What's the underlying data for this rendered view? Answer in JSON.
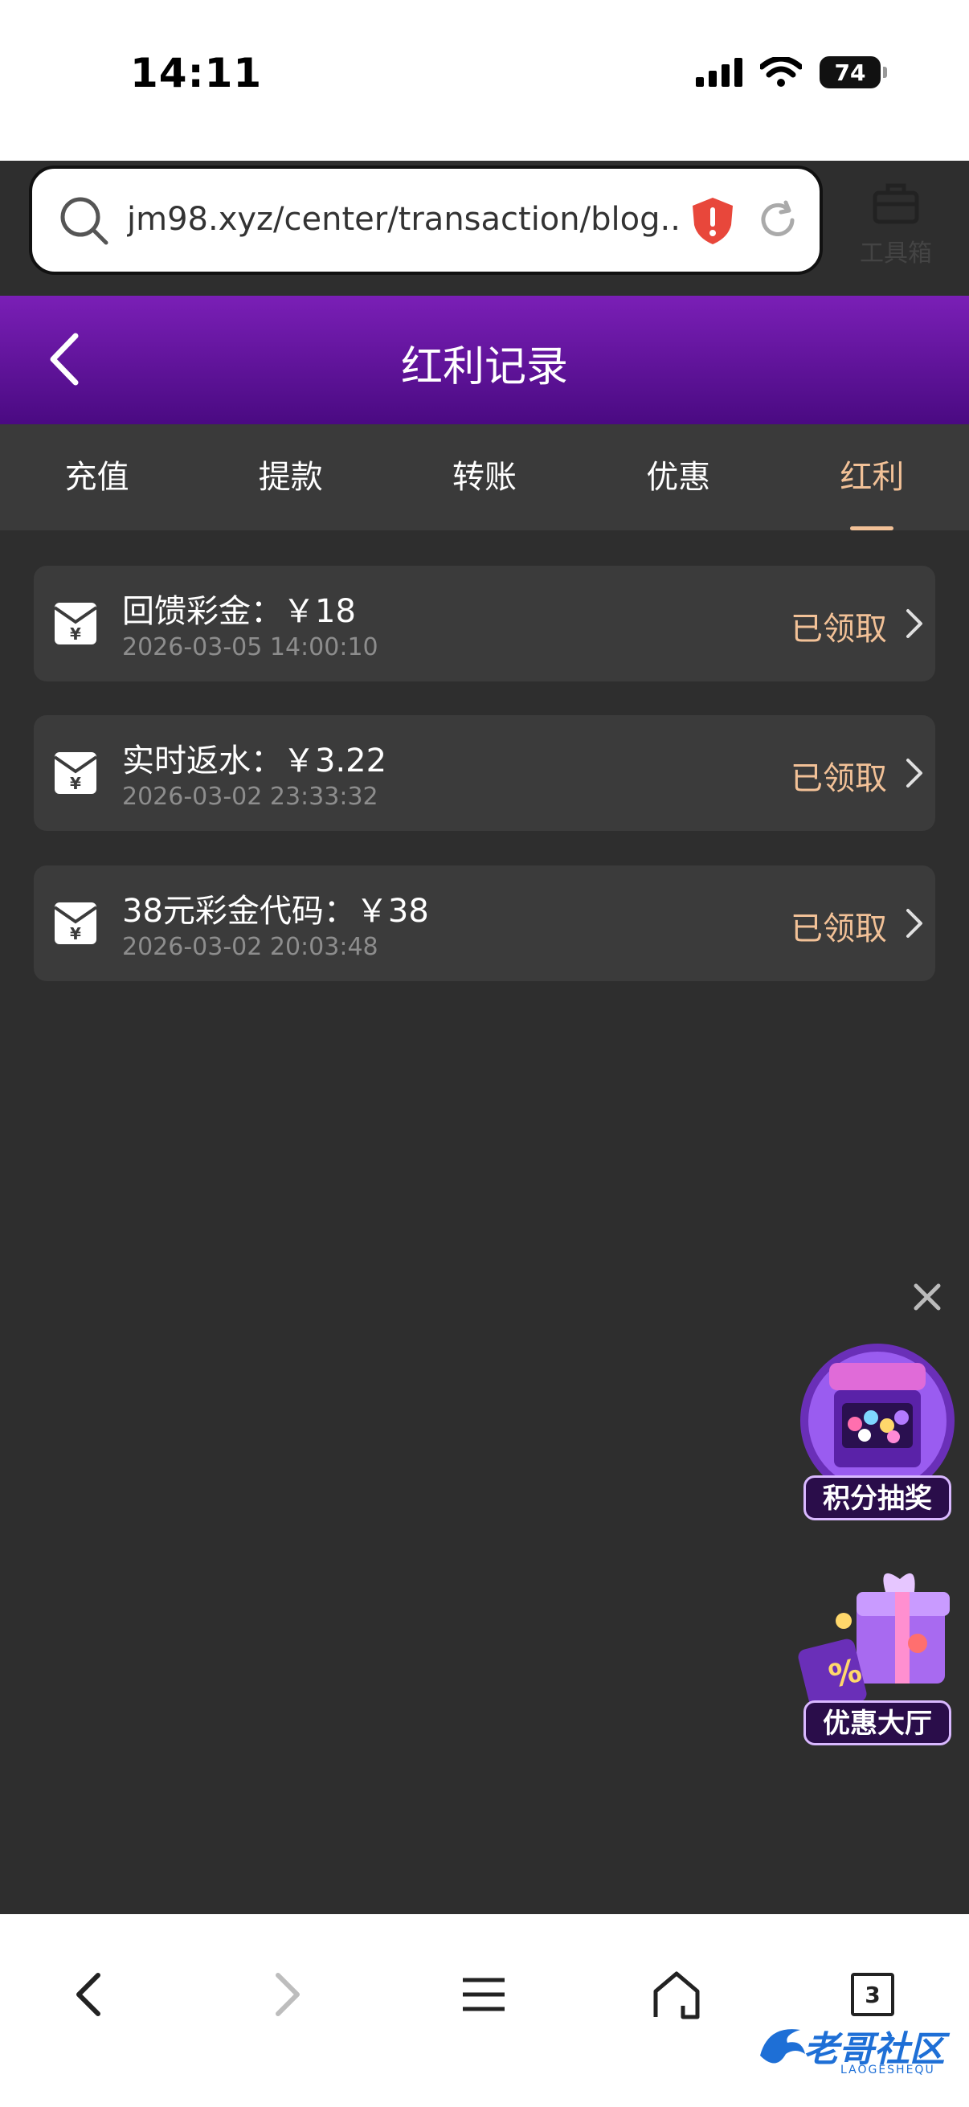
{
  "status_bar": {
    "time": "14:11",
    "battery": "74"
  },
  "browser": {
    "url": "jm98.xyz/center/transaction/blog....",
    "toolbox_label": "工具箱"
  },
  "header": {
    "title": "红利记录"
  },
  "tabs": [
    {
      "label": "充值"
    },
    {
      "label": "提款"
    },
    {
      "label": "转账"
    },
    {
      "label": "优惠"
    },
    {
      "label": "红利",
      "active": true
    }
  ],
  "records": [
    {
      "title": "回馈彩金：￥18",
      "date": "2026-03-05 14:00:10",
      "status": "已领取"
    },
    {
      "title": "实时返水：￥3.22",
      "date": "2026-03-02 23:33:32",
      "status": "已领取"
    },
    {
      "title": "38元彩金代码：￥38",
      "date": "2026-03-02 20:03:48",
      "status": "已领取"
    }
  ],
  "promos": {
    "lottery_label": "积分抽奖",
    "offers_label": "优惠大厅"
  },
  "bottom_nav": {
    "tab_count": "3"
  },
  "watermark": {
    "text": "老哥社区",
    "sub": "LAOGESHEQU"
  },
  "colors": {
    "accent": "#f2c197",
    "header_top": "#7a1fb6",
    "header_bottom": "#4a0a82",
    "background": "#2e2e2e"
  }
}
